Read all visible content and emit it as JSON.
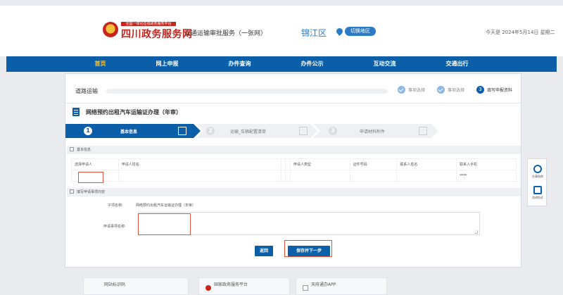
{
  "header": {
    "logo_small": "全国一体化在线政务服务平台",
    "logo_main": "四川政务服务网",
    "system_name": "交通运输审批服务（一张网）",
    "region": "锦江区",
    "switch_region": "切换地区",
    "date_text": "今天是 2024年5月14日 星期二"
  },
  "nav": {
    "items": [
      "首页",
      "网上申报",
      "办件查询",
      "办件公示",
      "互动交流",
      "交通出行"
    ]
  },
  "breadcrumb": {
    "title": "道路运输",
    "steps": [
      "事项选择",
      "事项选择",
      "填写申报资料"
    ],
    "current_step_num": "3"
  },
  "form": {
    "title": "网络预约出租汽车运输证办理（年审）",
    "wizard": [
      {
        "num": "1",
        "label": "基本信息"
      },
      {
        "num": "2",
        "label": "运输_车辆配置清单"
      },
      {
        "num": "3",
        "label": "申请材料附件"
      }
    ],
    "section_basic": "基本信息",
    "table_headers": [
      "选择申请人",
      "申请人姓名",
      "",
      "",
      "申请人类型",
      "证件号码",
      "联系人姓名",
      "联系人手机"
    ],
    "table_values": [
      "",
      "",
      "",
      "",
      "",
      "",
      "",
      "****"
    ],
    "section_request": "填写申请事项内容",
    "sub_item_label": "子项名称:",
    "sub_item_value": "网络预约出租汽车运输证办理（年审）",
    "request_name_label": "申请事项名称:",
    "request_name_value": ""
  },
  "buttons": {
    "back": "返回",
    "save_next": "保存并下一步"
  },
  "float": {
    "item1": "办事指南",
    "item2": "咨询投诉"
  },
  "footer": {
    "left": "网站标识码",
    "mid": "国家政务服务平台",
    "right": "天府通办APP"
  },
  "colors": {
    "brand_blue": "#0b5ea8",
    "brand_red": "#c7241c",
    "highlight": "#e5533c"
  }
}
